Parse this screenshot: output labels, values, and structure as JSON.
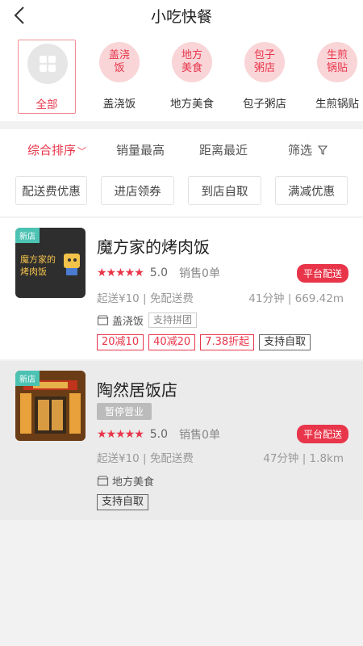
{
  "header": {
    "title": "小吃快餐"
  },
  "categories": [
    {
      "circle_text": "",
      "label": "全部",
      "active": true
    },
    {
      "circle_text": "盖浇饭",
      "label": "盖浇饭"
    },
    {
      "circle_text": "地方美食",
      "label": "地方美食"
    },
    {
      "circle_text": "包子粥店",
      "label": "包子粥店"
    },
    {
      "circle_text": "生煎锅贴",
      "label": "生煎锅贴"
    }
  ],
  "sort": {
    "comprehensive": "综合排序",
    "sales": "销量最高",
    "distance": "距离最近",
    "filter": "筛选"
  },
  "chips": [
    "配送费优惠",
    "进店领券",
    "到店自取",
    "满减优惠"
  ],
  "shops": [
    {
      "new_tag": "新店",
      "thumb_text": "魔方家的烤肉饭",
      "name": "魔方家的烤肉饭",
      "stars": "★★★★★",
      "rating": "5.0",
      "sold": "销售0单",
      "platform": "平台配送",
      "min_order": "起送¥10 | 免配送费",
      "dist": "41分钟 | 669.42m",
      "category": "盖浇饭",
      "group_tag": "支持拼团",
      "promos": [
        "20减10",
        "40减20",
        "7.38折起"
      ],
      "pickup": "支持自取"
    },
    {
      "new_tag": "新店",
      "name": "陶然居饭店",
      "closed": "暂停营业",
      "stars": "★★★★★",
      "rating": "5.0",
      "sold": "销售0单",
      "platform": "平台配送",
      "min_order": "起送¥10 | 免配送费",
      "dist": "47分钟 | 1.8km",
      "category": "地方美食",
      "pickup": "支持自取"
    }
  ],
  "colors": {
    "accent": "#e8354a",
    "new_tag": "#4cc2b3"
  }
}
